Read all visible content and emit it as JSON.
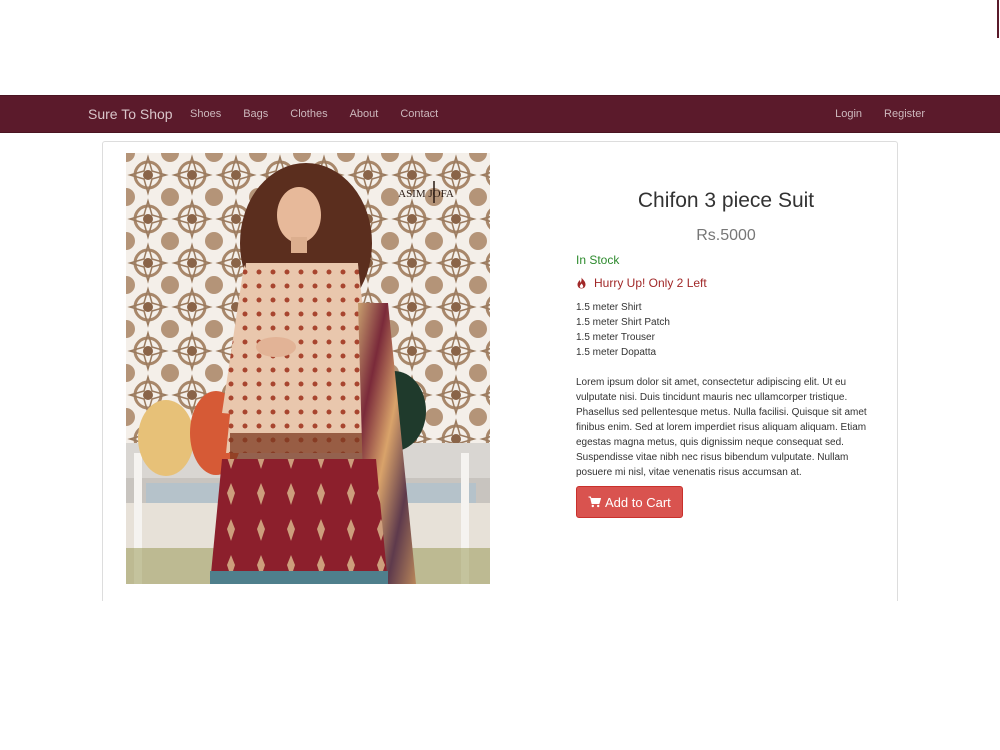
{
  "nav": {
    "brand": "Sure To Shop",
    "links": [
      "Shoes",
      "Bags",
      "Clothes",
      "About",
      "Contact"
    ],
    "right": [
      "Login",
      "Register"
    ]
  },
  "product": {
    "image_watermark": "ASIM JOFA",
    "title": "Chifon 3 piece Suit",
    "price": "Rs.5000",
    "stock": "In Stock",
    "hurry": "Hurry Up! Only 2 Left",
    "hurry_icon": "fire-icon",
    "specs": [
      "1.5 meter Shirt",
      "1.5 meter Shirt Patch",
      "1.5 meter Trouser",
      "1.5 meter Dopatta"
    ],
    "description": "Lorem ipsum dolor sit amet, consectetur adipiscing elit. Ut eu vulputate nisi. Duis tincidunt mauris nec ullamcorper tristique. Phasellus sed pellentesque metus. Nulla facilisi. Quisque sit amet finibus enim. Sed at lorem imperdiet risus aliquam aliquam. Etiam egestas magna metus, quis dignissim neque consequat sed. Suspendisse vitae nibh nec risus bibendum vulputate. Nullam posuere mi nisl, vitae venenatis risus accumsan at.",
    "cart_label": "Add to Cart",
    "cart_icon": "shopping-cart-icon"
  },
  "colors": {
    "navbar": "#5b1a2b",
    "in_stock": "#2d8a2d",
    "hurry": "#a12828",
    "button": "#d9534f"
  }
}
